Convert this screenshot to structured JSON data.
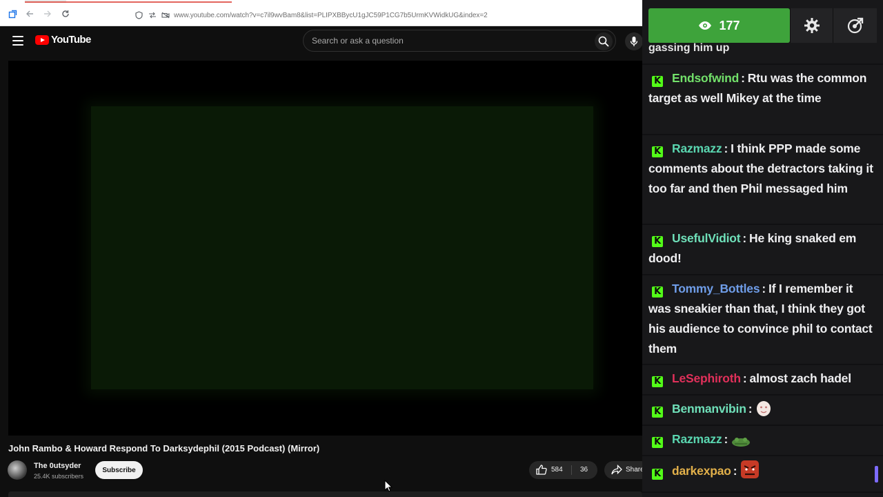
{
  "browser": {
    "url": "www.youtube.com/watch?v=c7il9wvBam8&list=PLIPXBBycU1gJC59P1CG7b5UrmKVWidkUG&index=2"
  },
  "youtube": {
    "logo_text": "YouTube",
    "search_placeholder": "Search or ask a question",
    "video_title": "John Rambo & Howard Respond To Darksydephil (2015 Podcast) (Mirror)",
    "channel_name": "The 0utsyder",
    "subscribers": "25.4K subscribers",
    "subscribe_label": "Subscribe",
    "likes": "584",
    "comments": "36",
    "share_label": "Share"
  },
  "chat": {
    "viewer_count": "177",
    "cut_text": "gassing him up",
    "messages": [
      {
        "user": "Endsofwind",
        "color": "#72e06a",
        "text": "Rtu was the common target as well Mikey at the time"
      },
      {
        "user": "Razmazz",
        "color": "#5ad6b0",
        "text": "I think PPP made some comments about the detractors taking it too far and then Phil messaged him"
      },
      {
        "user": "UsefulVidiot",
        "color": "#6fe0b9",
        "text": "He king snaked em dood!"
      },
      {
        "user": "Tommy_Bottles",
        "color": "#6f9de8",
        "text": "If I remember it was sneakier than that, I think they got his audience to convince phil to contact them"
      },
      {
        "user": "LeSephiroth",
        "color": "#e0305a",
        "text": "almost zach hadel"
      },
      {
        "user": "Benmanvibin",
        "color": "#6fe0b9",
        "text": ""
      },
      {
        "user": "Razmazz",
        "color": "#5ad6b0",
        "text": ""
      },
      {
        "user": "darkexpao",
        "color": "#e2b04a",
        "text": ""
      }
    ]
  },
  "icons": {
    "eye": "eye-icon",
    "gear": "gear-icon",
    "popout": "popout-icon",
    "kick": "kick-badge-icon"
  }
}
